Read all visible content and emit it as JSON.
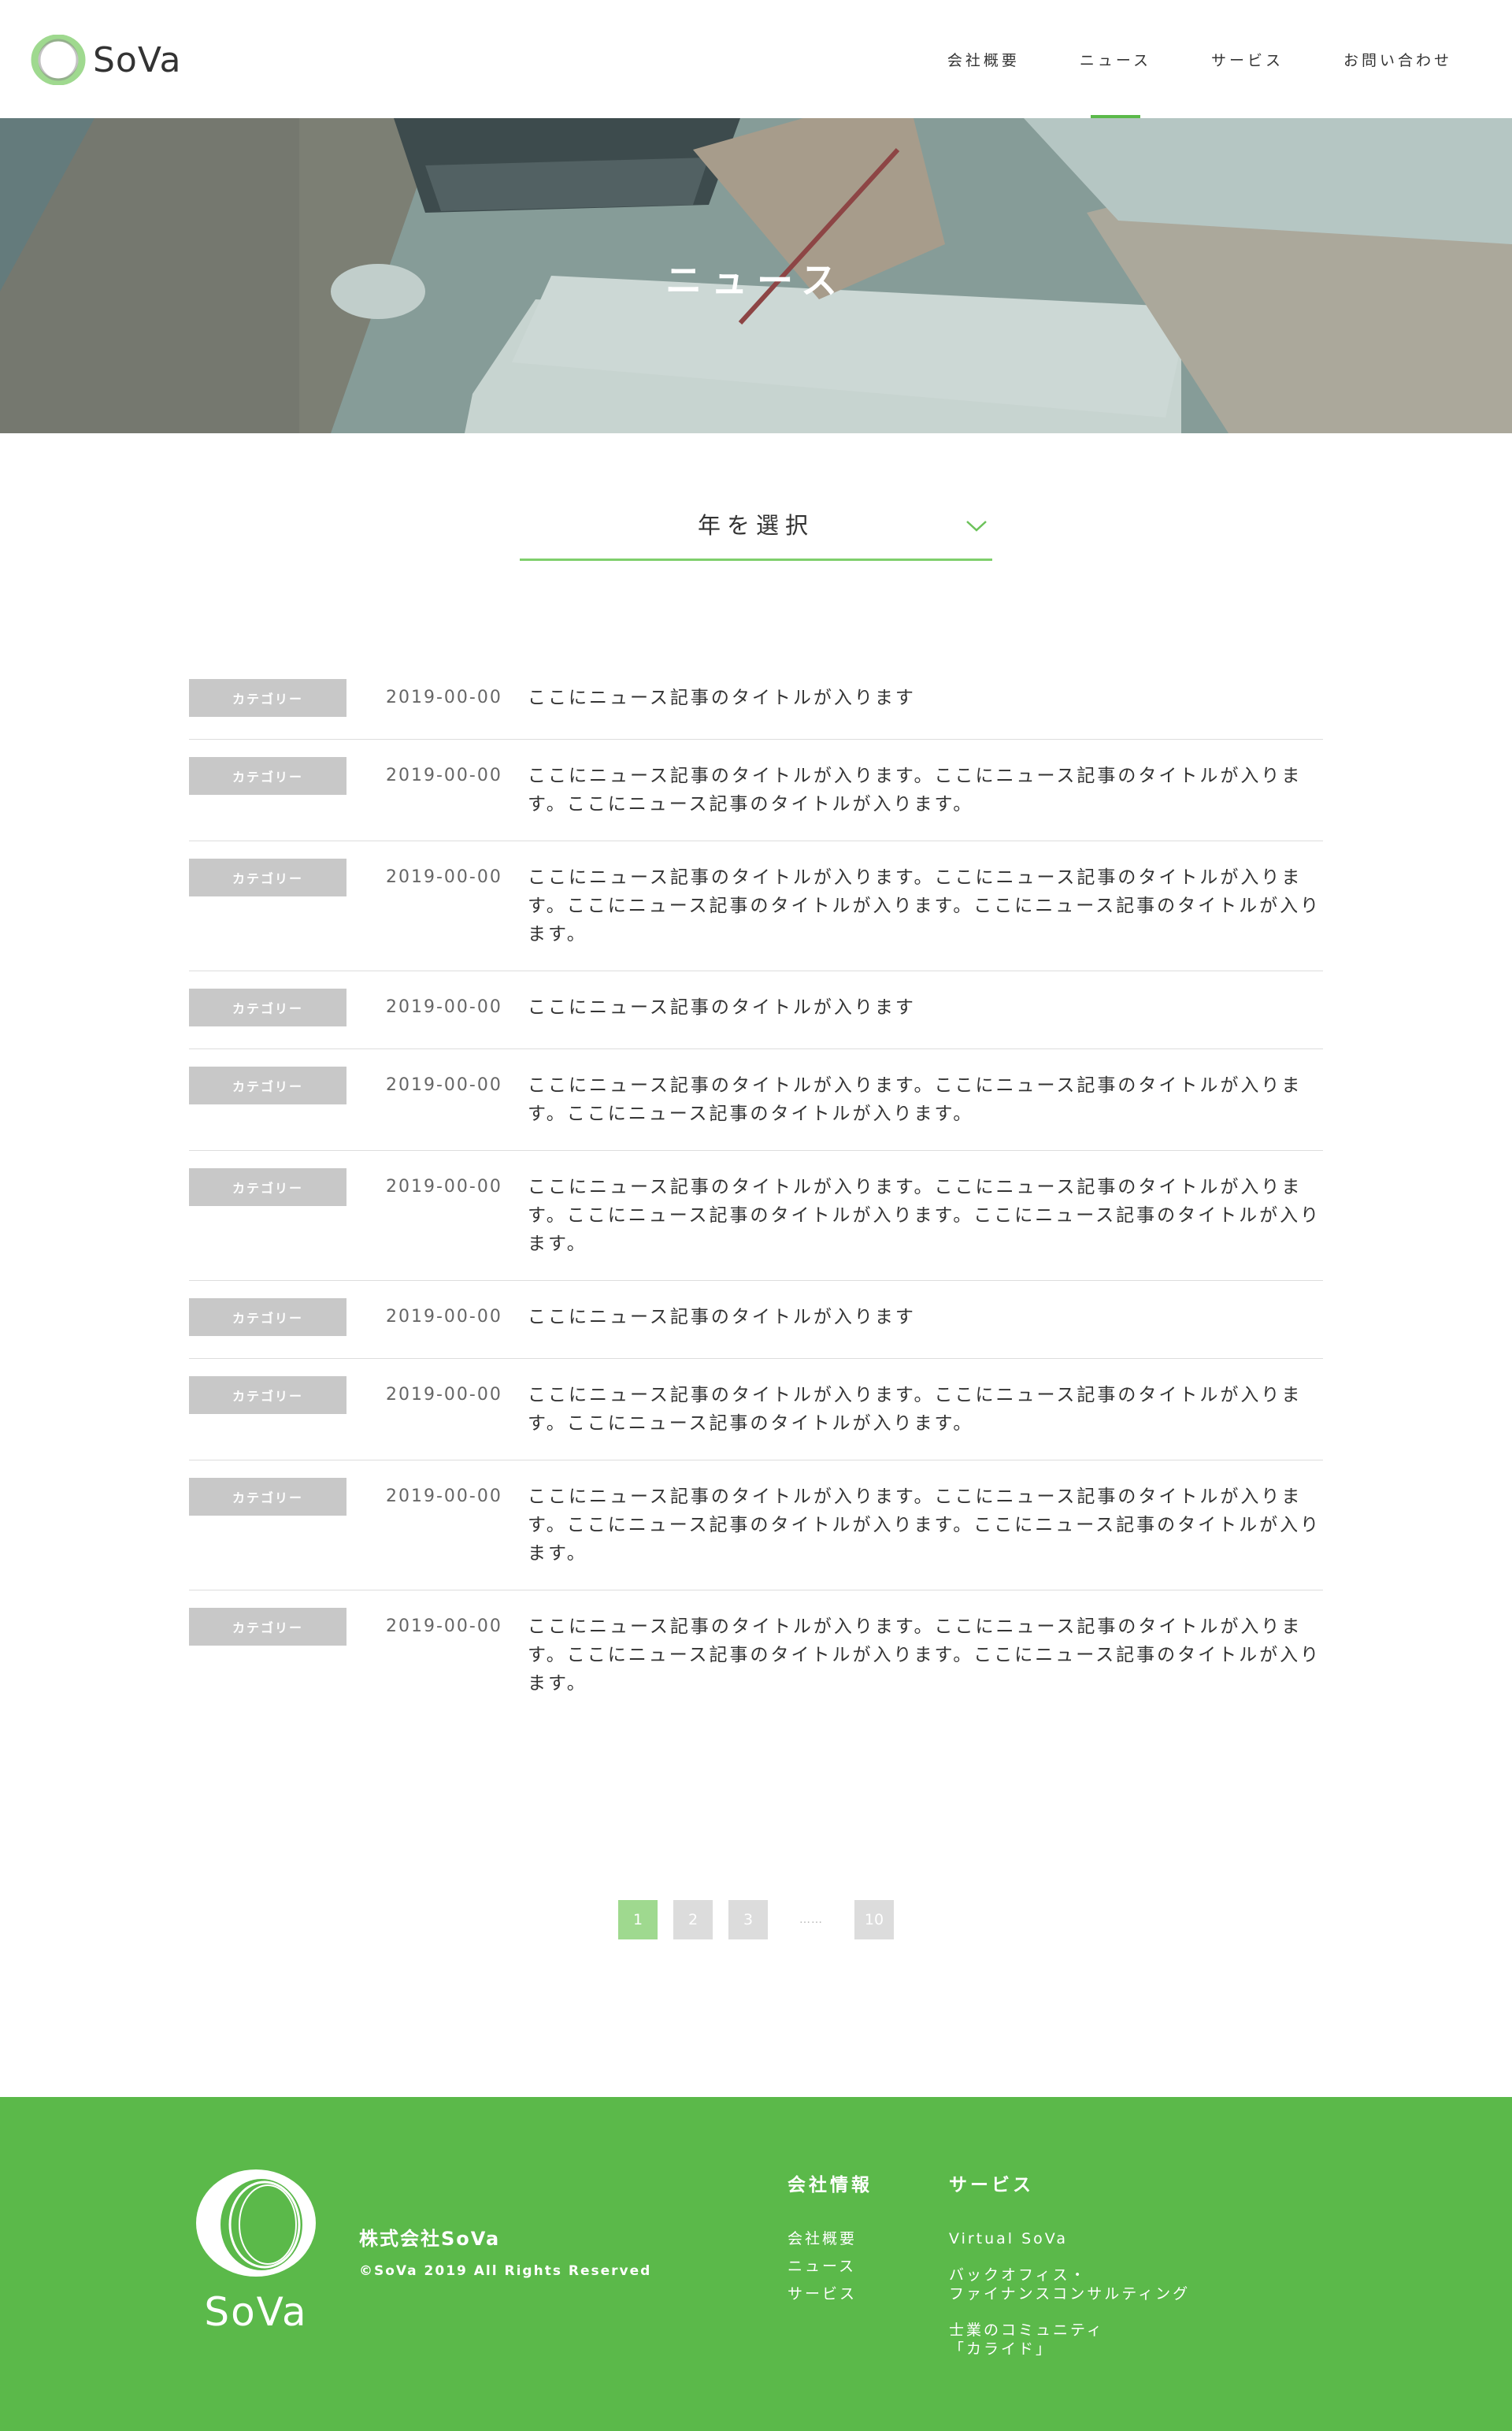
{
  "header": {
    "logo_text": "SoVa",
    "nav": [
      "会社概要",
      "ニュース",
      "サービス",
      "お問い合わせ"
    ],
    "active_index": 1
  },
  "hero": {
    "title": "ニュース"
  },
  "year_select": {
    "label": "年を選択"
  },
  "news": [
    {
      "category": "カテゴリー",
      "date": "2019-00-00",
      "title": "ここにニュース記事のタイトルが入ります"
    },
    {
      "category": "カテゴリー",
      "date": "2019-00-00",
      "title": "ここにニュース記事のタイトルが入ります。ここにニュース記事のタイトルが入ります。ここにニュース記事のタイトルが入ります。"
    },
    {
      "category": "カテゴリー",
      "date": "2019-00-00",
      "title": "ここにニュース記事のタイトルが入ります。ここにニュース記事のタイトルが入ります。ここにニュース記事のタイトルが入ります。ここにニュース記事のタイトルが入ります。"
    },
    {
      "category": "カテゴリー",
      "date": "2019-00-00",
      "title": "ここにニュース記事のタイトルが入ります"
    },
    {
      "category": "カテゴリー",
      "date": "2019-00-00",
      "title": "ここにニュース記事のタイトルが入ります。ここにニュース記事のタイトルが入ります。ここにニュース記事のタイトルが入ります。"
    },
    {
      "category": "カテゴリー",
      "date": "2019-00-00",
      "title": "ここにニュース記事のタイトルが入ります。ここにニュース記事のタイトルが入ります。ここにニュース記事のタイトルが入ります。ここにニュース記事のタイトルが入ります。"
    },
    {
      "category": "カテゴリー",
      "date": "2019-00-00",
      "title": "ここにニュース記事のタイトルが入ります"
    },
    {
      "category": "カテゴリー",
      "date": "2019-00-00",
      "title": "ここにニュース記事のタイトルが入ります。ここにニュース記事のタイトルが入ります。ここにニュース記事のタイトルが入ります。"
    },
    {
      "category": "カテゴリー",
      "date": "2019-00-00",
      "title": "ここにニュース記事のタイトルが入ります。ここにニュース記事のタイトルが入ります。ここにニュース記事のタイトルが入ります。ここにニュース記事のタイトルが入ります。"
    },
    {
      "category": "カテゴリー",
      "date": "2019-00-00",
      "title": "ここにニュース記事のタイトルが入ります。ここにニュース記事のタイトルが入ります。ここにニュース記事のタイトルが入ります。ここにニュース記事のタイトルが入ります。"
    }
  ],
  "pagination": {
    "pages": [
      "1",
      "2",
      "3"
    ],
    "ellipsis": "……",
    "last": "10",
    "current": "1"
  },
  "footer": {
    "logo_text": "SoVa",
    "company_name": "株式会社SoVa",
    "copyright": "©SoVa 2019 All Rights Reserved",
    "info_heading": "会社情報",
    "info_links": [
      "会社概要",
      "ニュース",
      "サービス"
    ],
    "service_heading": "サービス",
    "service_links": [
      "Virtual SoVa",
      "バックオフィス・\nファイナンスコンサルティング",
      "士業のコミュニティ\n「カライド」"
    ]
  },
  "colors": {
    "brand_green": "#5bb94a",
    "light_green": "#9fd98f",
    "category_gray": "#c8c8c8"
  }
}
